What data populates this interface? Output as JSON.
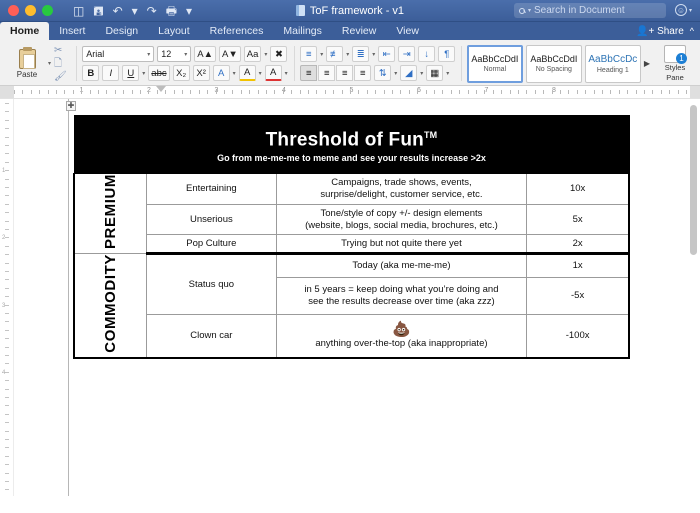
{
  "window": {
    "title": "ToF framework - v1",
    "traffic_lights": [
      "close",
      "minimize",
      "zoom"
    ],
    "quick_access": [
      "sidebar-toggle-icon",
      "save-icon",
      "undo-icon",
      "redo-icon",
      "print-icon",
      "customize-toolbar-icon"
    ],
    "search_placeholder": "Search in Document",
    "account_icon": "smiley-face-icon"
  },
  "ribbon": {
    "tabs": [
      {
        "label": "Home",
        "active": true
      },
      {
        "label": "Insert",
        "active": false
      },
      {
        "label": "Design",
        "active": false
      },
      {
        "label": "Layout",
        "active": false
      },
      {
        "label": "References",
        "active": false
      },
      {
        "label": "Mailings",
        "active": false
      },
      {
        "label": "Review",
        "active": false
      },
      {
        "label": "View",
        "active": false
      }
    ],
    "share_label": "Share",
    "collapse_icon": "chevron-up-icon",
    "paste": {
      "label": "Paste",
      "cut_icon": "scissors-icon",
      "copy_icon": "copy-icon",
      "format_painter_icon": "paintbrush-icon"
    },
    "font": {
      "family": "Arial",
      "size": "12",
      "bold": "B",
      "italic": "I",
      "underline": "U",
      "strikethrough": "abc",
      "subscript": "X₂",
      "superscript": "X²",
      "grow_font": "A▲",
      "shrink_font": "A▼",
      "change_case": "Aa",
      "clear_formatting": "A",
      "text_effects": "A",
      "highlight": "A",
      "font_color": "A"
    },
    "paragraph": {
      "bullets_icon": "bulleted-list-icon",
      "numbering_icon": "numbered-list-icon",
      "multilevel_icon": "multilevel-list-icon",
      "decrease_indent_icon": "decrease-indent-icon",
      "increase_indent_icon": "increase-indent-icon",
      "sort_icon": "sort-icon",
      "show_marks_icon": "pilcrow-icon",
      "align_left_icon": "align-left-icon",
      "align_center_icon": "align-center-icon",
      "align_right_icon": "align-right-icon",
      "justify_icon": "justify-icon",
      "line_spacing_icon": "line-spacing-icon",
      "shading_icon": "shading-icon",
      "borders_icon": "borders-icon"
    },
    "styles": [
      {
        "sample": "AaBbCcDdI",
        "name": "Normal",
        "selected": true,
        "heading": false
      },
      {
        "sample": "AaBbCcDdI",
        "name": "No Spacing",
        "selected": false,
        "heading": false
      },
      {
        "sample": "AaBbCcDc",
        "name": "Heading 1",
        "selected": false,
        "heading": true
      }
    ],
    "styles_more_icon": "chevron-right-icon",
    "styles_pane_label": "Styles\nPane"
  },
  "ruler": {
    "numbers": [
      "1",
      "2",
      "3",
      "4",
      "5",
      "6",
      "7",
      "8"
    ],
    "vertical_numbers": [
      "1",
      "2",
      "3",
      "4"
    ]
  },
  "document": {
    "header": {
      "title": "Threshold of Fun",
      "title_tm": "TM",
      "subtitle": "Go from me-me-me to meme and see your results increase >2x"
    },
    "sections": [
      {
        "label": "PREMIUM",
        "rows": [
          {
            "name": "Entertaining",
            "desc": [
              "Campaigns, trade shows, events,",
              "surprise/delight, customer service, etc."
            ],
            "value": "10x",
            "emoji": ""
          },
          {
            "name": "Unserious",
            "desc": [
              "Tone/style of copy +/- design elements",
              "(website, blogs, social media, brochures, etc.)"
            ],
            "value": "5x",
            "emoji": ""
          },
          {
            "name": "Pop Culture",
            "desc": [
              "Trying but not quite there yet"
            ],
            "value": "2x",
            "emoji": ""
          }
        ]
      },
      {
        "label": "COMMODITY",
        "rows": [
          {
            "name": "Status quo",
            "desc": [
              "Today (aka me-me-me)"
            ],
            "value": "1x",
            "emoji": ""
          },
          {
            "name": "",
            "desc": [
              "in 5 years = keep doing what you’re doing and",
              "see the results decrease over time (aka zzz)"
            ],
            "value": "-5x",
            "emoji": ""
          },
          {
            "name": "Clown car",
            "desc": [
              "anything over-the-top (aka inappropriate)"
            ],
            "value": "-100x",
            "emoji": "💩"
          }
        ]
      }
    ]
  },
  "colors": {
    "titlebar": "#3c5e99",
    "ribbon_bg": "#f1f1f1",
    "header_band": "#000000",
    "accent_blue": "#2e74b5",
    "page_bg": "#ffffff"
  }
}
